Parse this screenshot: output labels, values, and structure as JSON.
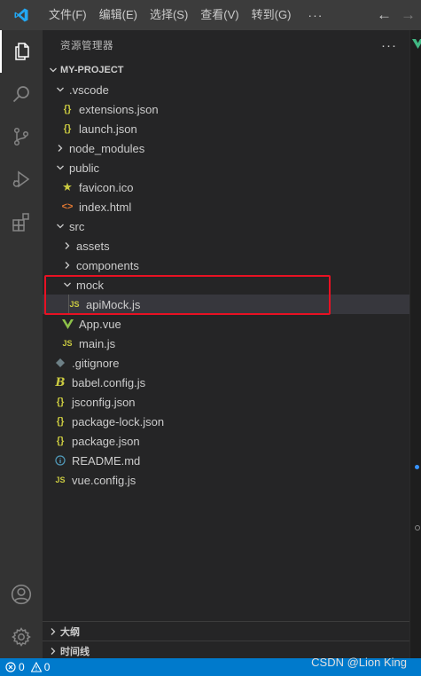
{
  "titlebar": {
    "menus": [
      "文件(F)",
      "编辑(E)",
      "选择(S)",
      "查看(V)",
      "转到(G)"
    ],
    "more": "···"
  },
  "sidebar": {
    "title": "资源管理器",
    "more": "···",
    "project": "MY-PROJECT",
    "tree": [
      {
        "label": ".vscode",
        "type": "folder",
        "open": true
      },
      {
        "label": "extensions.json",
        "type": "json"
      },
      {
        "label": "launch.json",
        "type": "json"
      },
      {
        "label": "node_modules",
        "type": "folder",
        "open": false
      },
      {
        "label": "public",
        "type": "folder",
        "open": true
      },
      {
        "label": "favicon.ico",
        "type": "star"
      },
      {
        "label": "index.html",
        "type": "html"
      },
      {
        "label": "src",
        "type": "folder",
        "open": true
      },
      {
        "label": "assets",
        "type": "folder",
        "open": false
      },
      {
        "label": "components",
        "type": "folder",
        "open": false
      },
      {
        "label": "mock",
        "type": "folder",
        "open": true
      },
      {
        "label": "apiMock.js",
        "type": "js"
      },
      {
        "label": "App.vue",
        "type": "vue"
      },
      {
        "label": "main.js",
        "type": "js"
      },
      {
        "label": ".gitignore",
        "type": "git"
      },
      {
        "label": "babel.config.js",
        "type": "babel"
      },
      {
        "label": "jsconfig.json",
        "type": "json"
      },
      {
        "label": "package-lock.json",
        "type": "json"
      },
      {
        "label": "package.json",
        "type": "json"
      },
      {
        "label": "README.md",
        "type": "info"
      },
      {
        "label": "vue.config.js",
        "type": "js"
      }
    ]
  },
  "panels": {
    "outline": "大纲",
    "timeline": "时间线"
  },
  "statusbar": {
    "errors": "0",
    "warnings": "0"
  },
  "watermark": "CSDN @Lion King",
  "colors": {
    "accent": "#007acc",
    "highlight": "#e81123",
    "json": "#cbcb41",
    "js": "#cbcb41",
    "vue": "#8dc149",
    "html": "#e37933",
    "info": "#519aba"
  }
}
